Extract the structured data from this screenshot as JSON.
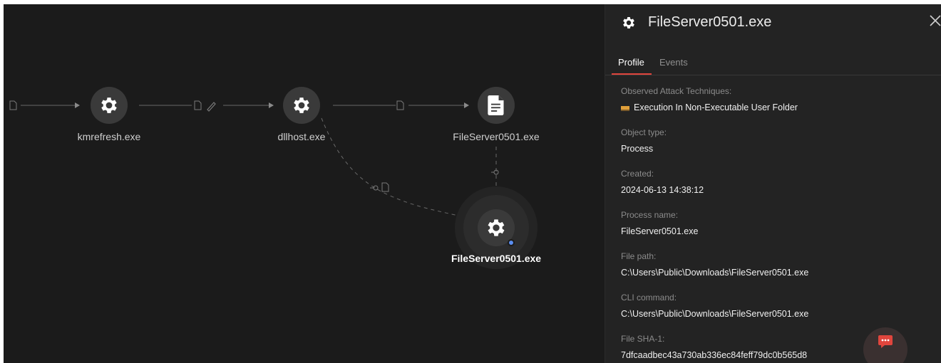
{
  "graph": {
    "nodes": [
      {
        "id": "kmrefresh",
        "label": "kmrefresh.exe",
        "icon": "gear-icon"
      },
      {
        "id": "dllhost",
        "label": "dllhost.exe",
        "icon": "gear-icon"
      },
      {
        "id": "fileserver-file",
        "label": "FileServer0501.exe",
        "icon": "document-icon"
      },
      {
        "id": "fileserver-process",
        "label": "FileServer0501.exe",
        "icon": "gear-icon",
        "selected": true
      }
    ],
    "edge_icons": [
      "file-icon",
      "file-icon",
      "pencil-icon",
      "file-icon",
      "network-icon",
      "file-icon",
      "network-icon"
    ]
  },
  "panel": {
    "title": "FileServer0501.exe",
    "title_icon": "gear-icon",
    "close_icon": "close-icon",
    "tabs": [
      {
        "label": "Profile",
        "active": true
      },
      {
        "label": "Events",
        "active": false
      }
    ],
    "fields": {
      "techniques": {
        "label": "Observed Attack Techniques:",
        "items": [
          {
            "name": "Execution In Non-Executable User Folder",
            "severity_colors": [
              "#e0a03a",
              "#7a5a2a"
            ]
          }
        ]
      },
      "object_type": {
        "label": "Object type:",
        "value": "Process"
      },
      "created": {
        "label": "Created:",
        "value": "2024-06-13 14:38:12"
      },
      "process_name": {
        "label": "Process name:",
        "value": "FileServer0501.exe"
      },
      "file_path": {
        "label": "File path:",
        "value": "C:\\Users\\Public\\Downloads\\FileServer0501.exe"
      },
      "cli_command": {
        "label": "CLI command:",
        "value": "C:\\Users\\Public\\Downloads\\FileServer0501.exe"
      },
      "sha1": {
        "label": "File SHA-1:",
        "value": "7dfcaadbec43a730ab336ec84feff79dc0b565d8"
      }
    },
    "chat_button_icon": "chat-icon"
  },
  "colors": {
    "background": "#1b1b1b",
    "panel": "#232323",
    "accent_red": "#e0453d",
    "status_blue": "#5b8ef0",
    "node_fill": "#3a3a3a"
  }
}
